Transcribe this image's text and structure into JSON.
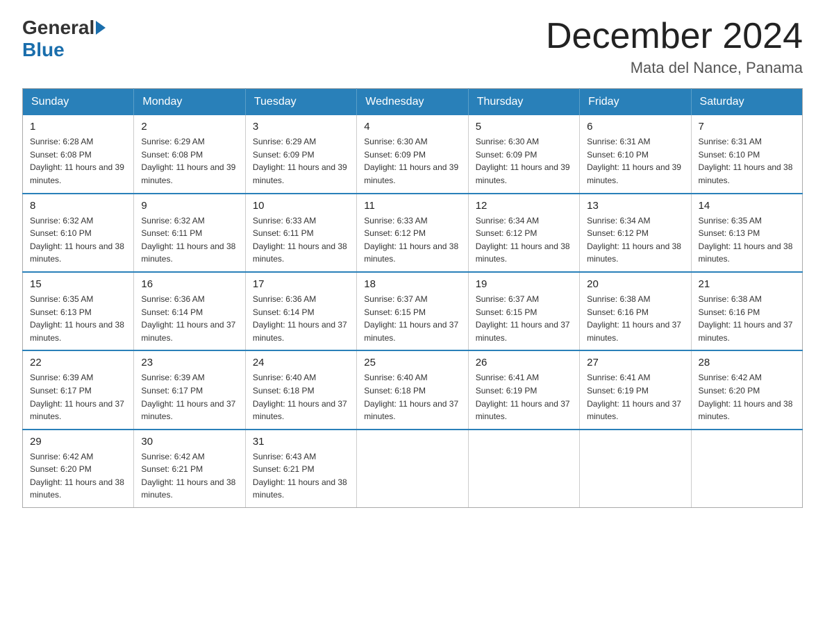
{
  "header": {
    "logo_general": "General",
    "logo_blue": "Blue",
    "month_title": "December 2024",
    "location": "Mata del Nance, Panama"
  },
  "days_of_week": [
    "Sunday",
    "Monday",
    "Tuesday",
    "Wednesday",
    "Thursday",
    "Friday",
    "Saturday"
  ],
  "weeks": [
    [
      {
        "day": "1",
        "sunrise": "6:28 AM",
        "sunset": "6:08 PM",
        "daylight": "11 hours and 39 minutes."
      },
      {
        "day": "2",
        "sunrise": "6:29 AM",
        "sunset": "6:08 PM",
        "daylight": "11 hours and 39 minutes."
      },
      {
        "day": "3",
        "sunrise": "6:29 AM",
        "sunset": "6:09 PM",
        "daylight": "11 hours and 39 minutes."
      },
      {
        "day": "4",
        "sunrise": "6:30 AM",
        "sunset": "6:09 PM",
        "daylight": "11 hours and 39 minutes."
      },
      {
        "day": "5",
        "sunrise": "6:30 AM",
        "sunset": "6:09 PM",
        "daylight": "11 hours and 39 minutes."
      },
      {
        "day": "6",
        "sunrise": "6:31 AM",
        "sunset": "6:10 PM",
        "daylight": "11 hours and 39 minutes."
      },
      {
        "day": "7",
        "sunrise": "6:31 AM",
        "sunset": "6:10 PM",
        "daylight": "11 hours and 38 minutes."
      }
    ],
    [
      {
        "day": "8",
        "sunrise": "6:32 AM",
        "sunset": "6:10 PM",
        "daylight": "11 hours and 38 minutes."
      },
      {
        "day": "9",
        "sunrise": "6:32 AM",
        "sunset": "6:11 PM",
        "daylight": "11 hours and 38 minutes."
      },
      {
        "day": "10",
        "sunrise": "6:33 AM",
        "sunset": "6:11 PM",
        "daylight": "11 hours and 38 minutes."
      },
      {
        "day": "11",
        "sunrise": "6:33 AM",
        "sunset": "6:12 PM",
        "daylight": "11 hours and 38 minutes."
      },
      {
        "day": "12",
        "sunrise": "6:34 AM",
        "sunset": "6:12 PM",
        "daylight": "11 hours and 38 minutes."
      },
      {
        "day": "13",
        "sunrise": "6:34 AM",
        "sunset": "6:12 PM",
        "daylight": "11 hours and 38 minutes."
      },
      {
        "day": "14",
        "sunrise": "6:35 AM",
        "sunset": "6:13 PM",
        "daylight": "11 hours and 38 minutes."
      }
    ],
    [
      {
        "day": "15",
        "sunrise": "6:35 AM",
        "sunset": "6:13 PM",
        "daylight": "11 hours and 38 minutes."
      },
      {
        "day": "16",
        "sunrise": "6:36 AM",
        "sunset": "6:14 PM",
        "daylight": "11 hours and 37 minutes."
      },
      {
        "day": "17",
        "sunrise": "6:36 AM",
        "sunset": "6:14 PM",
        "daylight": "11 hours and 37 minutes."
      },
      {
        "day": "18",
        "sunrise": "6:37 AM",
        "sunset": "6:15 PM",
        "daylight": "11 hours and 37 minutes."
      },
      {
        "day": "19",
        "sunrise": "6:37 AM",
        "sunset": "6:15 PM",
        "daylight": "11 hours and 37 minutes."
      },
      {
        "day": "20",
        "sunrise": "6:38 AM",
        "sunset": "6:16 PM",
        "daylight": "11 hours and 37 minutes."
      },
      {
        "day": "21",
        "sunrise": "6:38 AM",
        "sunset": "6:16 PM",
        "daylight": "11 hours and 37 minutes."
      }
    ],
    [
      {
        "day": "22",
        "sunrise": "6:39 AM",
        "sunset": "6:17 PM",
        "daylight": "11 hours and 37 minutes."
      },
      {
        "day": "23",
        "sunrise": "6:39 AM",
        "sunset": "6:17 PM",
        "daylight": "11 hours and 37 minutes."
      },
      {
        "day": "24",
        "sunrise": "6:40 AM",
        "sunset": "6:18 PM",
        "daylight": "11 hours and 37 minutes."
      },
      {
        "day": "25",
        "sunrise": "6:40 AM",
        "sunset": "6:18 PM",
        "daylight": "11 hours and 37 minutes."
      },
      {
        "day": "26",
        "sunrise": "6:41 AM",
        "sunset": "6:19 PM",
        "daylight": "11 hours and 37 minutes."
      },
      {
        "day": "27",
        "sunrise": "6:41 AM",
        "sunset": "6:19 PM",
        "daylight": "11 hours and 37 minutes."
      },
      {
        "day": "28",
        "sunrise": "6:42 AM",
        "sunset": "6:20 PM",
        "daylight": "11 hours and 38 minutes."
      }
    ],
    [
      {
        "day": "29",
        "sunrise": "6:42 AM",
        "sunset": "6:20 PM",
        "daylight": "11 hours and 38 minutes."
      },
      {
        "day": "30",
        "sunrise": "6:42 AM",
        "sunset": "6:21 PM",
        "daylight": "11 hours and 38 minutes."
      },
      {
        "day": "31",
        "sunrise": "6:43 AM",
        "sunset": "6:21 PM",
        "daylight": "11 hours and 38 minutes."
      },
      null,
      null,
      null,
      null
    ]
  ]
}
